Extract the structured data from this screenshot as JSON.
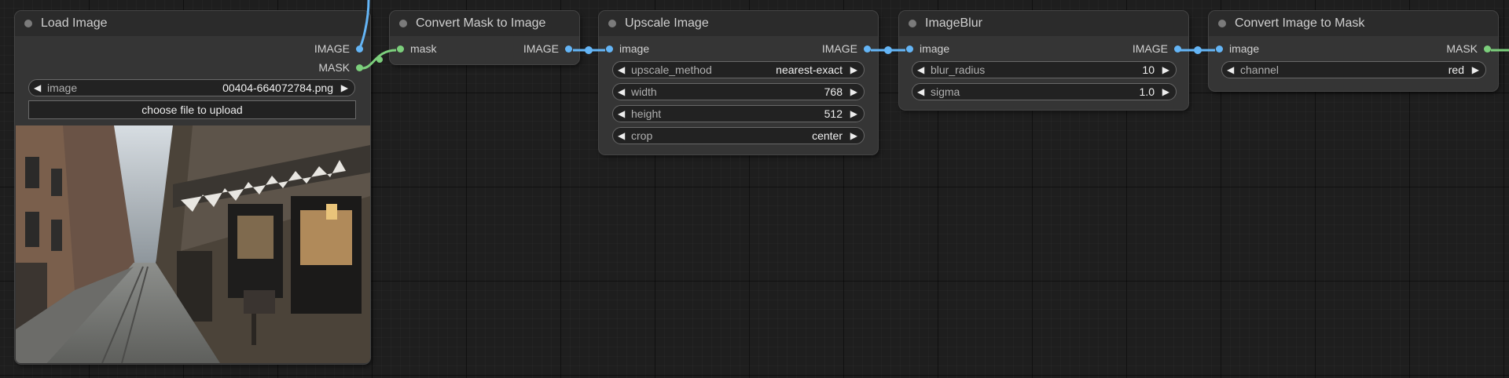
{
  "nodes": {
    "load_image": {
      "title": "Load Image",
      "outputs": [
        "IMAGE",
        "MASK"
      ],
      "image_widget": {
        "label": "image",
        "value": "00404-664072784.png"
      },
      "upload_label": "choose file to upload"
    },
    "mask_to_image": {
      "title": "Convert Mask to Image",
      "input": "mask",
      "output": "IMAGE"
    },
    "upscale": {
      "title": "Upscale Image",
      "input": "image",
      "output": "IMAGE",
      "widgets": [
        {
          "label": "upscale_method",
          "value": "nearest-exact"
        },
        {
          "label": "width",
          "value": "768"
        },
        {
          "label": "height",
          "value": "512"
        },
        {
          "label": "crop",
          "value": "center"
        }
      ]
    },
    "blur": {
      "title": "ImageBlur",
      "input": "image",
      "output": "IMAGE",
      "widgets": [
        {
          "label": "blur_radius",
          "value": "10"
        },
        {
          "label": "sigma",
          "value": "1.0"
        }
      ]
    },
    "image_to_mask": {
      "title": "Convert Image to Mask",
      "input": "image",
      "output": "MASK",
      "widgets": [
        {
          "label": "channel",
          "value": "red"
        }
      ]
    }
  },
  "colors": {
    "image_link": "#64b5f6",
    "mask_link": "#7ccf7c",
    "node_body": "#353535",
    "node_title": "#2b2b2b",
    "canvas": "#1e1e1e"
  },
  "icons": {
    "decrement": "◀",
    "increment": "▶"
  }
}
